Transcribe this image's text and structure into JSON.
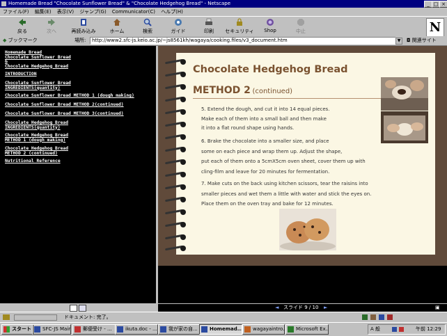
{
  "window": {
    "title": "Homemade Bread \"Chocolate Sunflower Bread\" & \"Chocolate Hedgehog Bread\" - Netscape",
    "controls": [
      "_",
      "□",
      "×"
    ]
  },
  "menubar": [
    "ファイル(F)",
    "編集(E)",
    "表示(V)",
    "ジャンプ(G)",
    "Communicator(C)",
    "ヘルプ(H)"
  ],
  "toolbar": [
    {
      "label": "戻る",
      "icon": "back-arrow-icon",
      "color": "#2a6b2a"
    },
    {
      "label": "次へ",
      "icon": "forward-arrow-icon",
      "color": "#2a6b2a",
      "disabled": true
    },
    {
      "label": "再読み込み",
      "icon": "reload-icon",
      "color": "#2b4aa0"
    },
    {
      "label": "ホーム",
      "icon": "home-icon",
      "color": "#8a5a2a"
    },
    {
      "label": "検索",
      "icon": "search-icon",
      "color": "#2b4aa0"
    },
    {
      "label": "ガイド",
      "icon": "guide-icon",
      "color": "#4a7ab0"
    },
    {
      "label": "印刷",
      "icon": "print-icon",
      "color": "#555555"
    },
    {
      "label": "セキュリティ",
      "icon": "security-lock-icon",
      "color": "#a08a20"
    },
    {
      "label": "Shop",
      "icon": "shop-icon",
      "color": "#7050a0"
    },
    {
      "label": "中止",
      "icon": "stop-icon",
      "color": "#808080",
      "disabled": true
    }
  ],
  "logo": "N",
  "locationbar": {
    "bookmarks_label": "ブックマーク",
    "location_label": "場所:",
    "url": "http://www2.sfc-js.keio.ac.jp/~js8561kh/wagaya/cooking.files/v3_document.htm",
    "related_label": "関連サイト"
  },
  "nav_links": [
    "Homemade Bread\nChocolate Sunflower Bread\n&\nChocolate Hedgehog Bread",
    "INTRODUCTION",
    "Chocolate Sunflower Bread\nINGREDIENTS(quantity)",
    "Chocolate Sunflower Bread METHOD 1 (dough making)",
    "Chocolate Sunflower Bread METHOD 2(continued)",
    "Chocolate Sunflower Bread METHOD 3(continued)",
    "Chocolate Hedgehog Bread\nINGREDIENTS(quantity)",
    "Chocolate Hedgehog Bread\nMETHOD 1 (dough making)",
    "Chocolate Hedgehog Bread\nMETHOD 2 (continued)",
    "Nutritional Reference"
  ],
  "slide": {
    "title": "Chocolate Hedgehog Bread",
    "subtitle_main": "METHOD 2",
    "subtitle_paren": "(continued)",
    "steps": [
      [
        "5. Extend the dough, and cut it into 14 equal pieces.",
        "Make each of    them into a small ball and then make",
        "it into a flat round shape using hands."
      ],
      [
        "6. Brake the chocolate into a smaller size, and place",
        "some on each piece and wrap them up. Adjust the shape,",
        "put each of them onto a 5cmX5cm oven sheet, cover them up with",
        "cling-film and leave for 20 minutes for fermentation."
      ],
      [
        "7. Make cuts on the back using kitchen scissors, tear the raisins into",
        "smaller pieces and wet them a little with water and stick the eyes on.",
        "Place them on the oven tray and bake for 12 minutes."
      ]
    ],
    "title_color": "#7a5230",
    "page_color": "#fbf7e4",
    "frame_color": "#604a3a"
  },
  "slide_nav": {
    "prev": "◄",
    "label": "スライド 9 / 10",
    "next": "►",
    "fullscreen": "▣"
  },
  "status": {
    "text": "ドキュメント: 完了。"
  },
  "taskbar": {
    "start": "スタート",
    "tasks": [
      {
        "label": "SFC-JS Main ...",
        "icon": "netscape-icon"
      },
      {
        "label": "郵便受け - ...",
        "icon": "mail-icon"
      },
      {
        "label": "ikuta.doc - ...",
        "icon": "word-icon"
      },
      {
        "label": "我が家の自...",
        "icon": "word-icon"
      },
      {
        "label": "Homemad...",
        "icon": "netscape-icon",
        "active": true
      },
      {
        "label": "wagayaintro...",
        "icon": "powerpoint-icon"
      },
      {
        "label": "Microsoft Ex...",
        "icon": "excel-icon"
      }
    ],
    "tray_text": "A 般",
    "clock": "午前 12:29"
  }
}
